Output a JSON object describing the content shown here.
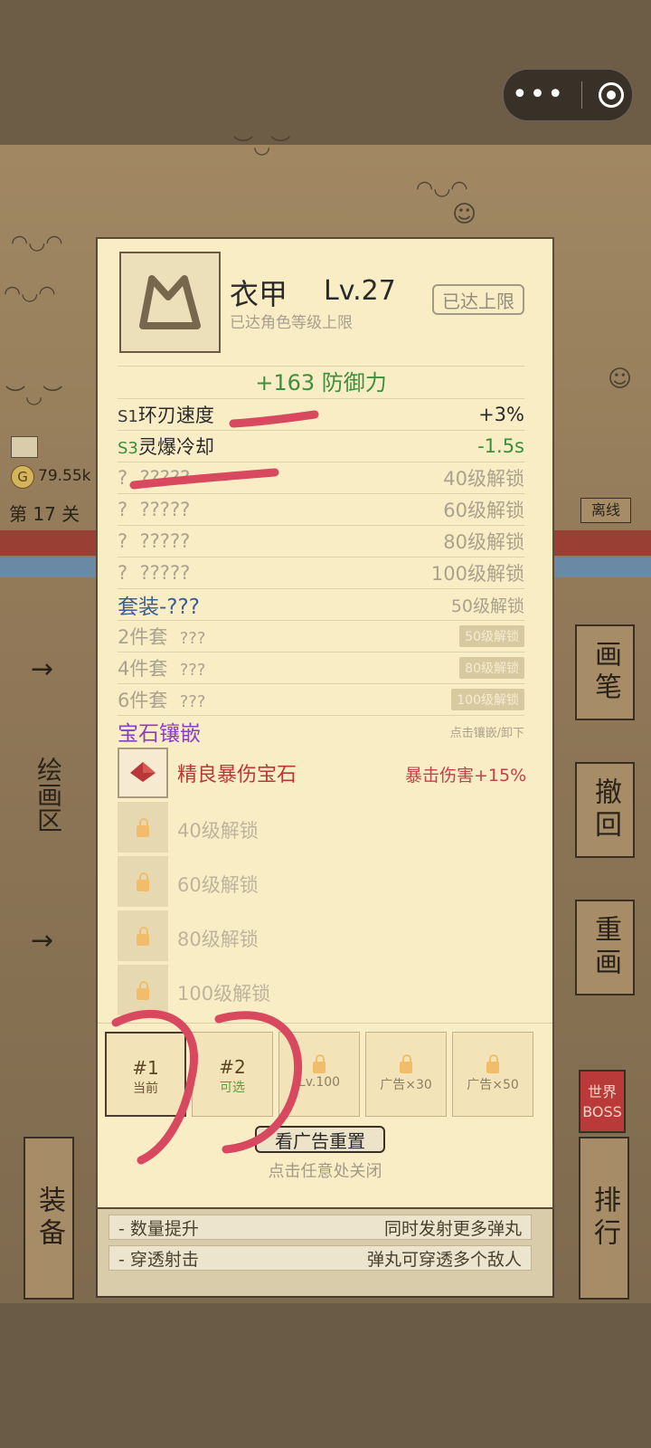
{
  "capsule": {
    "more_icon": "more-dots-icon",
    "close_icon": "target-circle-icon"
  },
  "game": {
    "coins": "79.55k",
    "level_text": "第 17 关",
    "offline": "离线",
    "left_area": "绘画区",
    "side_buttons": [
      "画笔",
      "撤回",
      "重画"
    ],
    "equip_button": "装备",
    "rank_button": "排行",
    "world_boss": [
      "世界",
      "BOSS"
    ],
    "arrow": "→"
  },
  "modal": {
    "item_name": "衣甲",
    "level": "Lv.27",
    "subtitle": "已达角色等级上限",
    "max_button": "已达上限",
    "main_stat": "+163 防御力",
    "stats": [
      {
        "slot": "S1",
        "name": "环刃速度",
        "value": "+3%"
      },
      {
        "slot": "S3",
        "name": "灵爆冷却",
        "value": "-1.5s"
      },
      {
        "slot": "?",
        "name": "?????",
        "value": "40级解锁"
      },
      {
        "slot": "?",
        "name": "?????",
        "value": "60级解锁"
      },
      {
        "slot": "?",
        "name": "?????",
        "value": "80级解锁"
      },
      {
        "slot": "?",
        "name": "?????",
        "value": "100级解锁"
      }
    ],
    "set": {
      "title": "套装-???",
      "unlock": "50级解锁",
      "items": [
        {
          "name": "2件套",
          "desc": "???",
          "tag": "50级解锁"
        },
        {
          "name": "4件套",
          "desc": "???",
          "tag": "80级解锁"
        },
        {
          "name": "6件套",
          "desc": "???",
          "tag": "100级解锁"
        }
      ]
    },
    "gems": {
      "title": "宝石镶嵌",
      "hint": "点击镶嵌/卸下",
      "filled": {
        "name": "精良暴伤宝石",
        "effect": "暴击伤害+15%"
      },
      "locked": [
        "40级解锁",
        "60级解锁",
        "80级解锁",
        "100级解锁"
      ]
    },
    "tabs": [
      {
        "big": "#1",
        "small": "当前"
      },
      {
        "big": "#2",
        "small": "可选"
      },
      {
        "small": "Lv.100"
      },
      {
        "small": "广告×30"
      },
      {
        "small": "广告×50"
      }
    ],
    "reset_button": "看广告重置",
    "close_hint": "点击任意处关闭"
  },
  "upgrades": [
    {
      "name": "- 数量提升",
      "desc": "同时发射更多弹丸"
    },
    {
      "name": "- 穿透射击",
      "desc": "弹丸可穿透多个敌人"
    }
  ],
  "colors": {
    "stat_green": "#3d8e3e",
    "gem_purple": "#8a3ec4",
    "gem_red": "#b8383a",
    "set_blue": "#3a5f8e",
    "annotation_red": "#d8485e"
  }
}
